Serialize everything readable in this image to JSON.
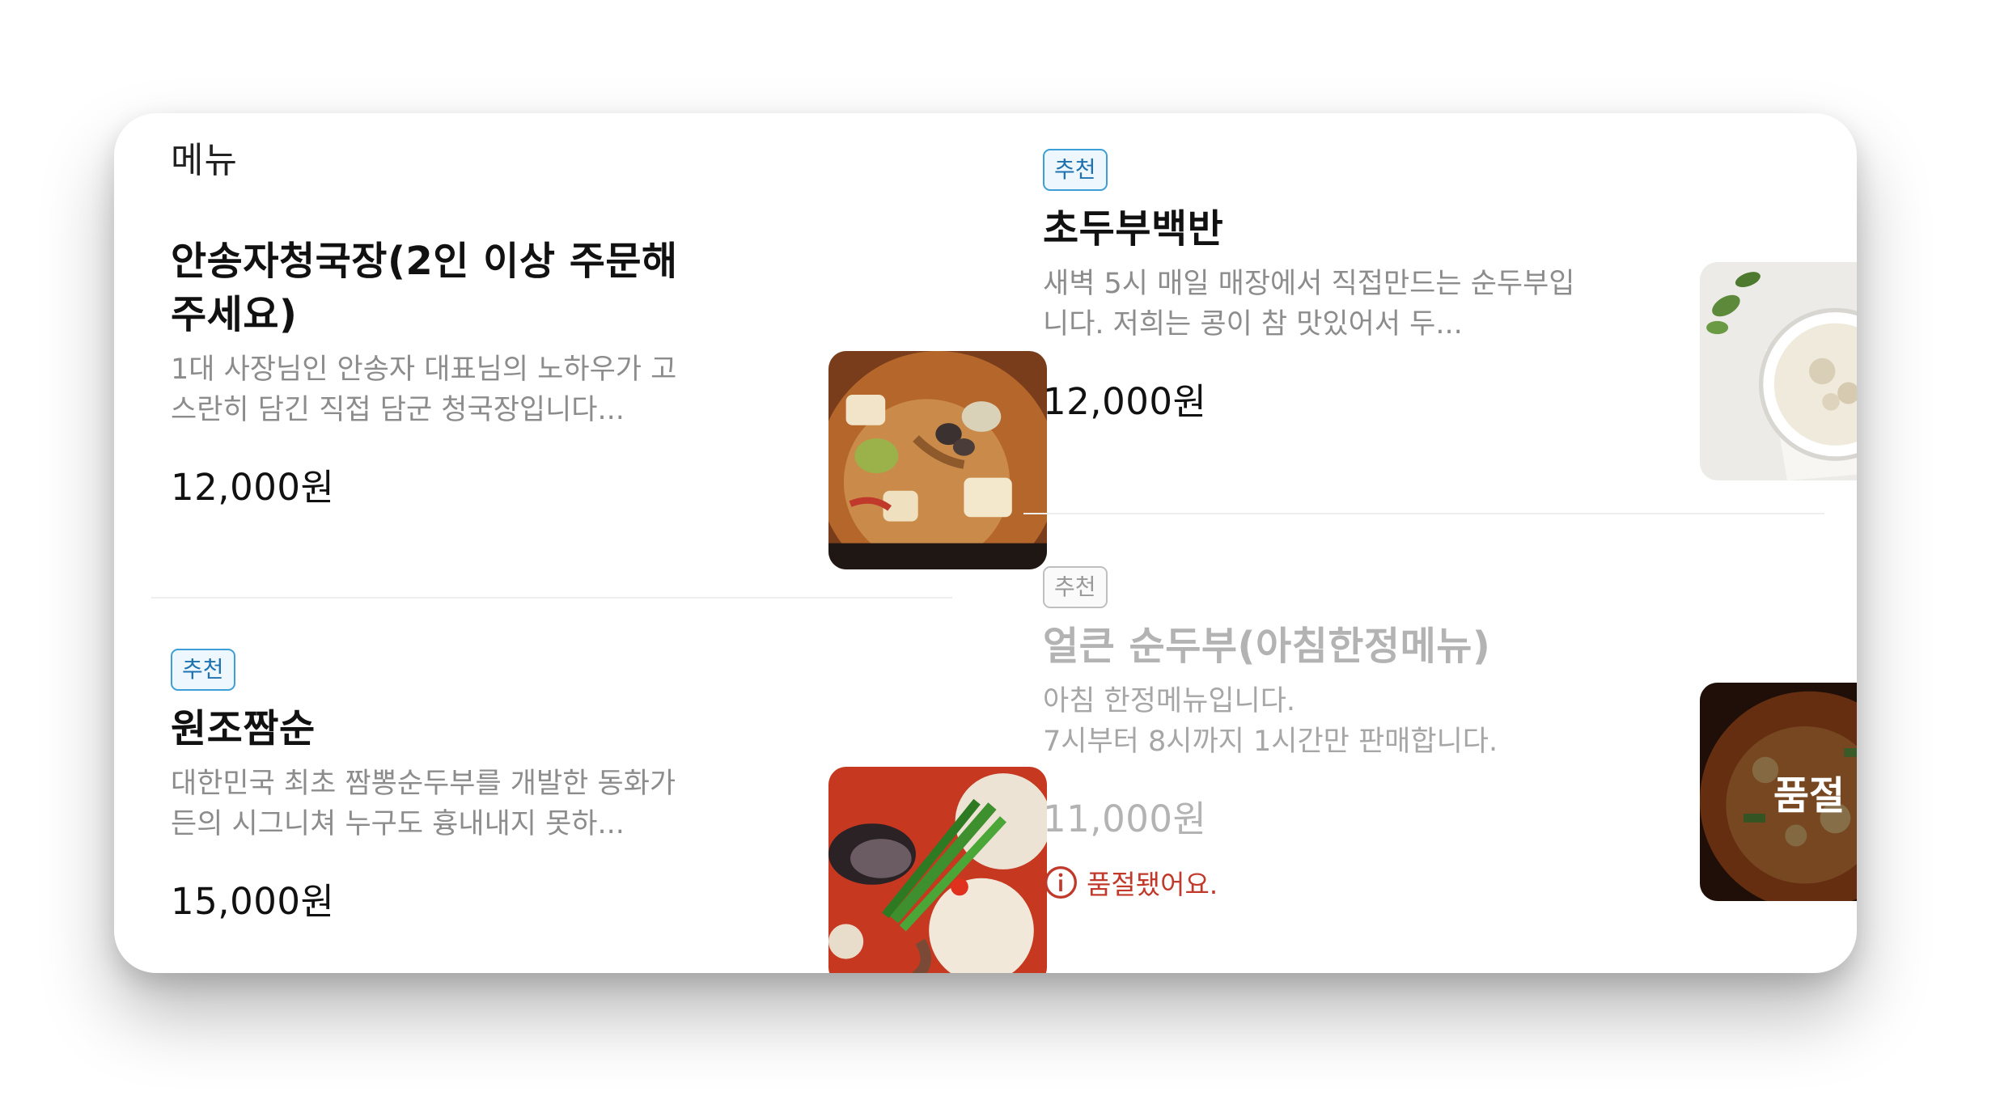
{
  "menu": {
    "section_title": "메뉴",
    "items": [
      {
        "name": "안송자청국장(2인 이상 주문해 주세요)",
        "description": "1대 사장님인 안송자 대표님의 노하우가 고스란히 담긴 직접 담군 청국장입니다...",
        "price": "12,000원",
        "badge": "",
        "image": "cheonggukjang-stew-photo"
      },
      {
        "name": "원조짬순",
        "description": "대한민국 최초 짬뽕순두부를 개발한 동화가든의 시그니쳐 누구도 흉내내지 못하...",
        "price": "15,000원",
        "badge": "추천",
        "image": "jjamppong-sundubu-photo"
      },
      {
        "name": "초두부백반",
        "description": "새벽 5시 매일 매장에서 직접만드는 순두부입니다. 저희는 콩이 참 맛있어서 두...",
        "price": "12,000원",
        "badge": "추천",
        "image": "chodubu-bowl-photo"
      },
      {
        "name": "얼큰 순두부(아침한정메뉴)",
        "description_lines": [
          "아침 한정메뉴입니다.",
          "7시부터 8시까지 1시간만 판매합니다."
        ],
        "price": "11,000원",
        "badge": "추천",
        "image": "spicy-sundubu-photo",
        "overlay_label": "품절",
        "notice": "품절됐어요."
      }
    ]
  },
  "colors": {
    "badge_border": "#3d9fd6",
    "badge_text": "#1e72b0",
    "soldout_text": "#c0392b",
    "muted_text": "#b3b3b3"
  }
}
